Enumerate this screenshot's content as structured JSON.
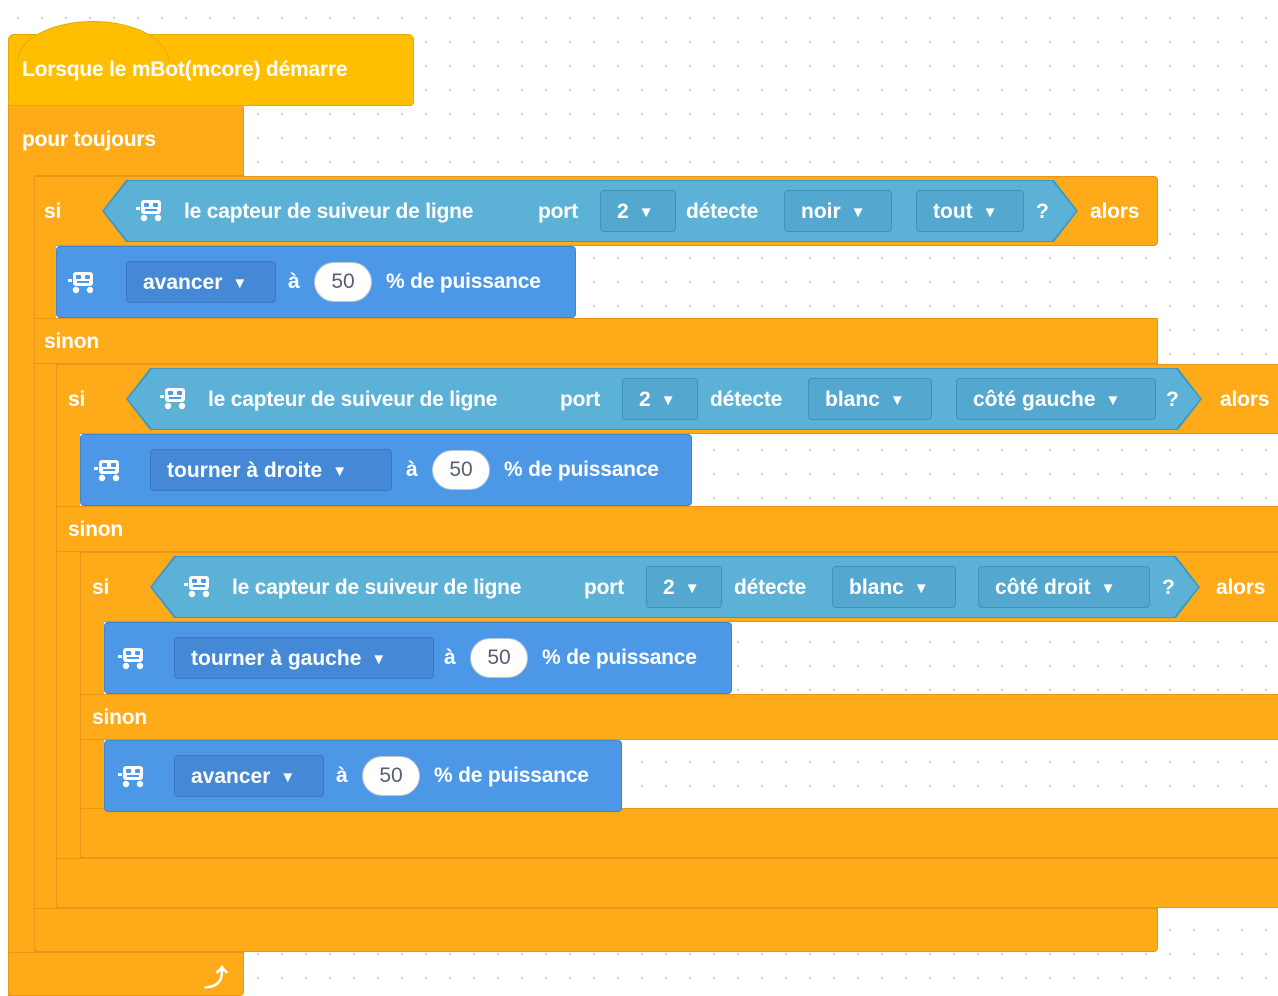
{
  "hat": {
    "label": "Lorsque le mBot(mcore) démarre"
  },
  "forever": {
    "label": "pour toujours",
    "loop_icon": "loop-arrow-icon"
  },
  "if1": {
    "if_label": "si",
    "sensor_label": "le capteur de suiveur de ligne",
    "port_label": "port",
    "port_value": "2",
    "detect_label": "détecte",
    "color_value": "noir",
    "side_value": "tout",
    "question": "?",
    "then_label": "alors",
    "else_label": "sinon"
  },
  "move1": {
    "action": "avancer",
    "a_label": "à",
    "power": "50",
    "suffix": "% de puissance"
  },
  "if2": {
    "if_label": "si",
    "sensor_label": "le capteur de suiveur de ligne",
    "port_label": "port",
    "port_value": "2",
    "detect_label": "détecte",
    "color_value": "blanc",
    "side_value": "côté gauche",
    "question": "?",
    "then_label": "alors",
    "else_label": "sinon"
  },
  "move2": {
    "action": "tourner à droite",
    "a_label": "à",
    "power": "50",
    "suffix": "% de puissance"
  },
  "if3": {
    "if_label": "si",
    "sensor_label": "le capteur de suiveur de ligne",
    "port_label": "port",
    "port_value": "2",
    "detect_label": "détecte",
    "color_value": "blanc",
    "side_value": "côté droit",
    "question": "?",
    "then_label": "alors",
    "else_label": "sinon"
  },
  "move3": {
    "action": "tourner à gauche",
    "a_label": "à",
    "power": "50",
    "suffix": "% de puissance"
  },
  "move4": {
    "action": "avancer",
    "a_label": "à",
    "power": "50",
    "suffix": "% de puissance"
  },
  "colors": {
    "hat": "#ffbf00",
    "control": "#ffab19",
    "sensor": "#5cb1d6",
    "motion": "#4c97e6",
    "canvas": "#ffffff"
  }
}
